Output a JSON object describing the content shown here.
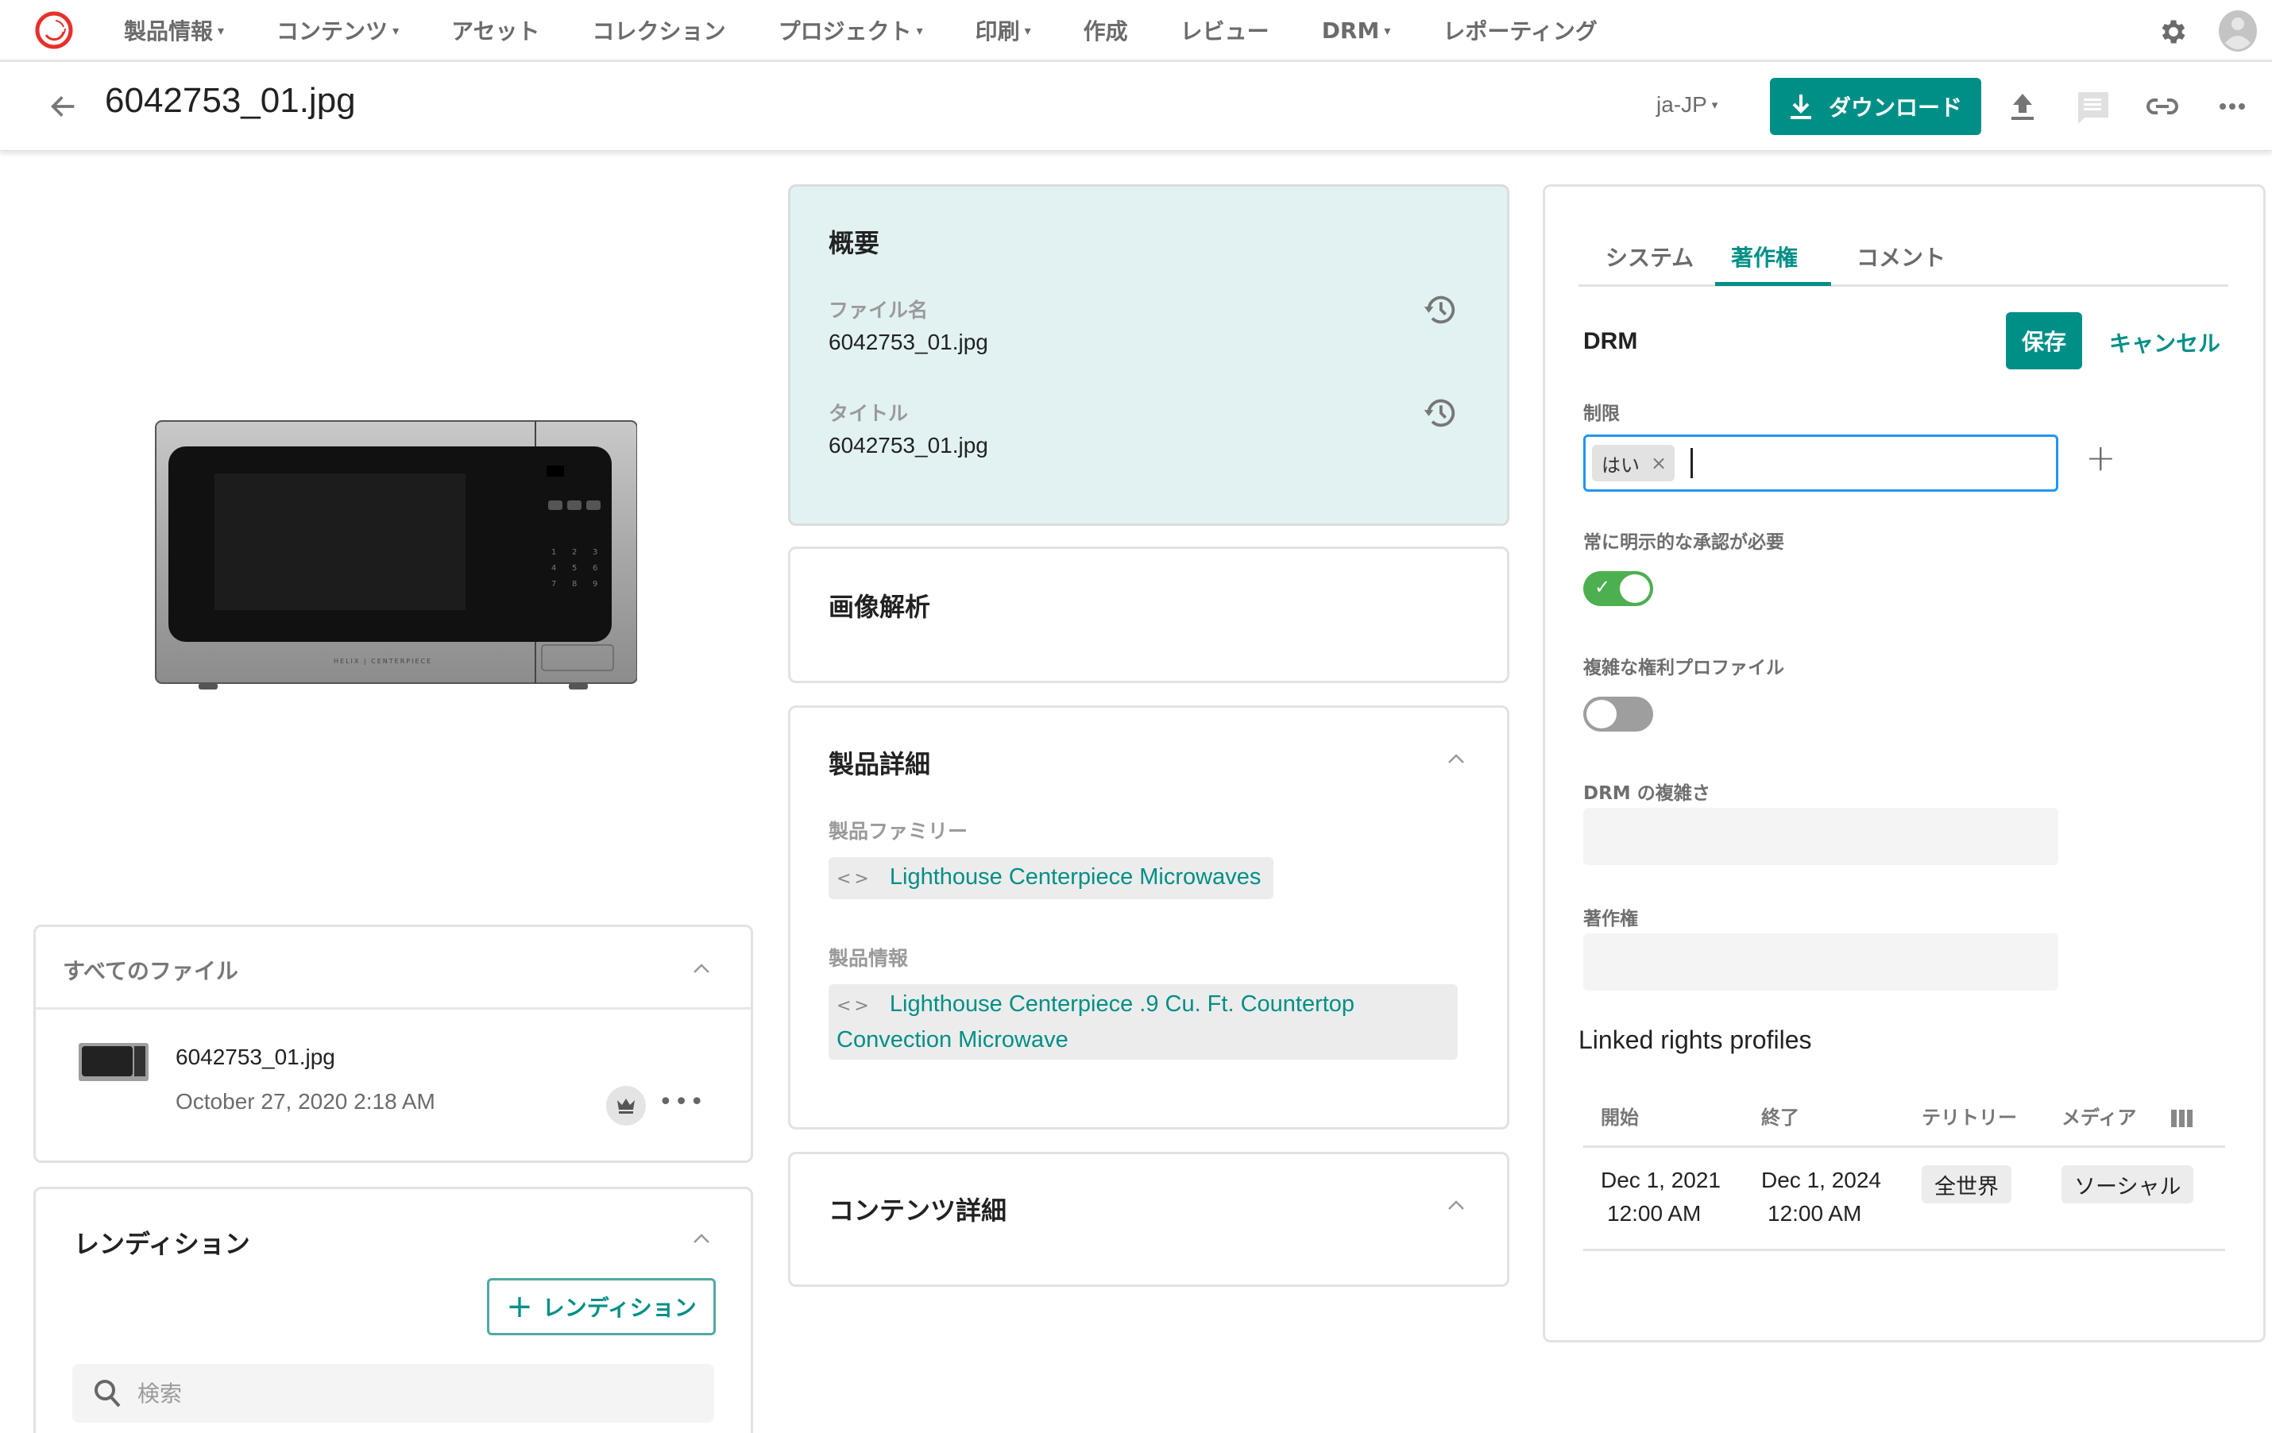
{
  "nav": {
    "items": [
      {
        "label": "製品情報",
        "dropdown": true
      },
      {
        "label": "コンテンツ",
        "dropdown": true
      },
      {
        "label": "アセット",
        "dropdown": false
      },
      {
        "label": "コレクション",
        "dropdown": false
      },
      {
        "label": "プロジェクト",
        "dropdown": true
      },
      {
        "label": "印刷",
        "dropdown": true
      },
      {
        "label": "作成",
        "dropdown": false
      },
      {
        "label": "レビュー",
        "dropdown": false
      },
      {
        "label": "DRM",
        "dropdown": true
      },
      {
        "label": "レポーティング",
        "dropdown": false
      }
    ],
    "caret": "▾"
  },
  "header": {
    "title": "6042753_01.jpg",
    "locale": "ja-JP",
    "download_label": "ダウンロード"
  },
  "left": {
    "all_files": {
      "title": "すべてのファイル",
      "file": {
        "name": "6042753_01.jpg",
        "date": "October 27, 2020 2:18 AM"
      },
      "more": "•••"
    },
    "renditions": {
      "title": "レンディション",
      "add_label": "レンディション",
      "add_plus": "+",
      "search_placeholder": "検索"
    }
  },
  "middle": {
    "summary": {
      "title": "概要",
      "fields": [
        {
          "label": "ファイル名",
          "value": "6042753_01.jpg"
        },
        {
          "label": "タイトル",
          "value": "6042753_01.jpg"
        }
      ]
    },
    "image_analysis": {
      "title": "画像解析"
    },
    "product_details": {
      "title": "製品詳細",
      "family_label": "製品ファミリー",
      "family_value": "Lighthouse Centerpiece Microwaves",
      "info_label": "製品情報",
      "info_value": "Lighthouse Centerpiece .9 Cu. Ft. Countertop Convection Microwave",
      "code_glyph": "<>"
    },
    "content_details": {
      "title": "コンテンツ詳細"
    }
  },
  "right": {
    "tabs": [
      {
        "label": "システム",
        "active": false
      },
      {
        "label": "著作権",
        "active": true
      },
      {
        "label": "コメント",
        "active": false
      }
    ],
    "drm_title": "DRM",
    "save_label": "保存",
    "cancel_label": "キャンセル",
    "restriction_label": "制限",
    "restriction_tags": [
      "はい"
    ],
    "tag_remove": "×",
    "add_plus": "+",
    "explicit_approval_label": "常に明示的な承認が必要",
    "explicit_approval_on": true,
    "complex_profile_label": "複雑な権利プロファイル",
    "complex_profile_on": false,
    "drm_complexity_label": "DRM の複雑さ",
    "copyright_label": "著作権",
    "linked_title": "Linked rights profiles",
    "table": {
      "headers": [
        "開始",
        "終了",
        "テリトリー",
        "メディア"
      ],
      "rows": [
        {
          "start_date": "Dec 1, 2021",
          "start_time": "12:00 AM",
          "end_date": "Dec 1, 2024",
          "end_time": "12:00 AM",
          "territory": "全世界",
          "media": "ソーシャル"
        }
      ]
    },
    "check": "✓"
  },
  "colors": {
    "accent": "#008f86",
    "toggle_on": "#4caf50",
    "toggle_off": "#9e9e9e",
    "focus_border": "#2196f3",
    "summary_bg": "#e2f2f2",
    "logo": "#e8302a"
  }
}
